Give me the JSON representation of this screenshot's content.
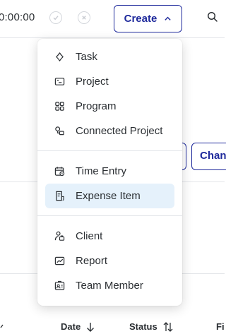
{
  "timer": {
    "value": "0:00:00"
  },
  "create_button": {
    "label": "Create"
  },
  "side_button_b": {
    "label": "Chan"
  },
  "menu": {
    "groups": [
      [
        {
          "label": "Task",
          "icon": "task-diamond-icon"
        },
        {
          "label": "Project",
          "icon": "project-icon"
        },
        {
          "label": "Program",
          "icon": "program-grid-icon"
        },
        {
          "label": "Connected Project",
          "icon": "connected-project-icon"
        }
      ],
      [
        {
          "label": "Time Entry",
          "icon": "calendar-clock-icon"
        },
        {
          "label": "Expense Item",
          "icon": "receipt-icon",
          "selected": true
        }
      ],
      [
        {
          "label": "Client",
          "icon": "client-icon"
        },
        {
          "label": "Report",
          "icon": "report-chart-icon"
        },
        {
          "label": "Team Member",
          "icon": "team-member-card-icon"
        }
      ]
    ]
  },
  "table": {
    "headers": [
      {
        "label": "Date"
      },
      {
        "label": "Status"
      },
      {
        "label": "Fi"
      }
    ]
  },
  "colors": {
    "accent": "#1f2a9c",
    "highlight": "#e5f1fb",
    "border": "#e4e6ea"
  }
}
